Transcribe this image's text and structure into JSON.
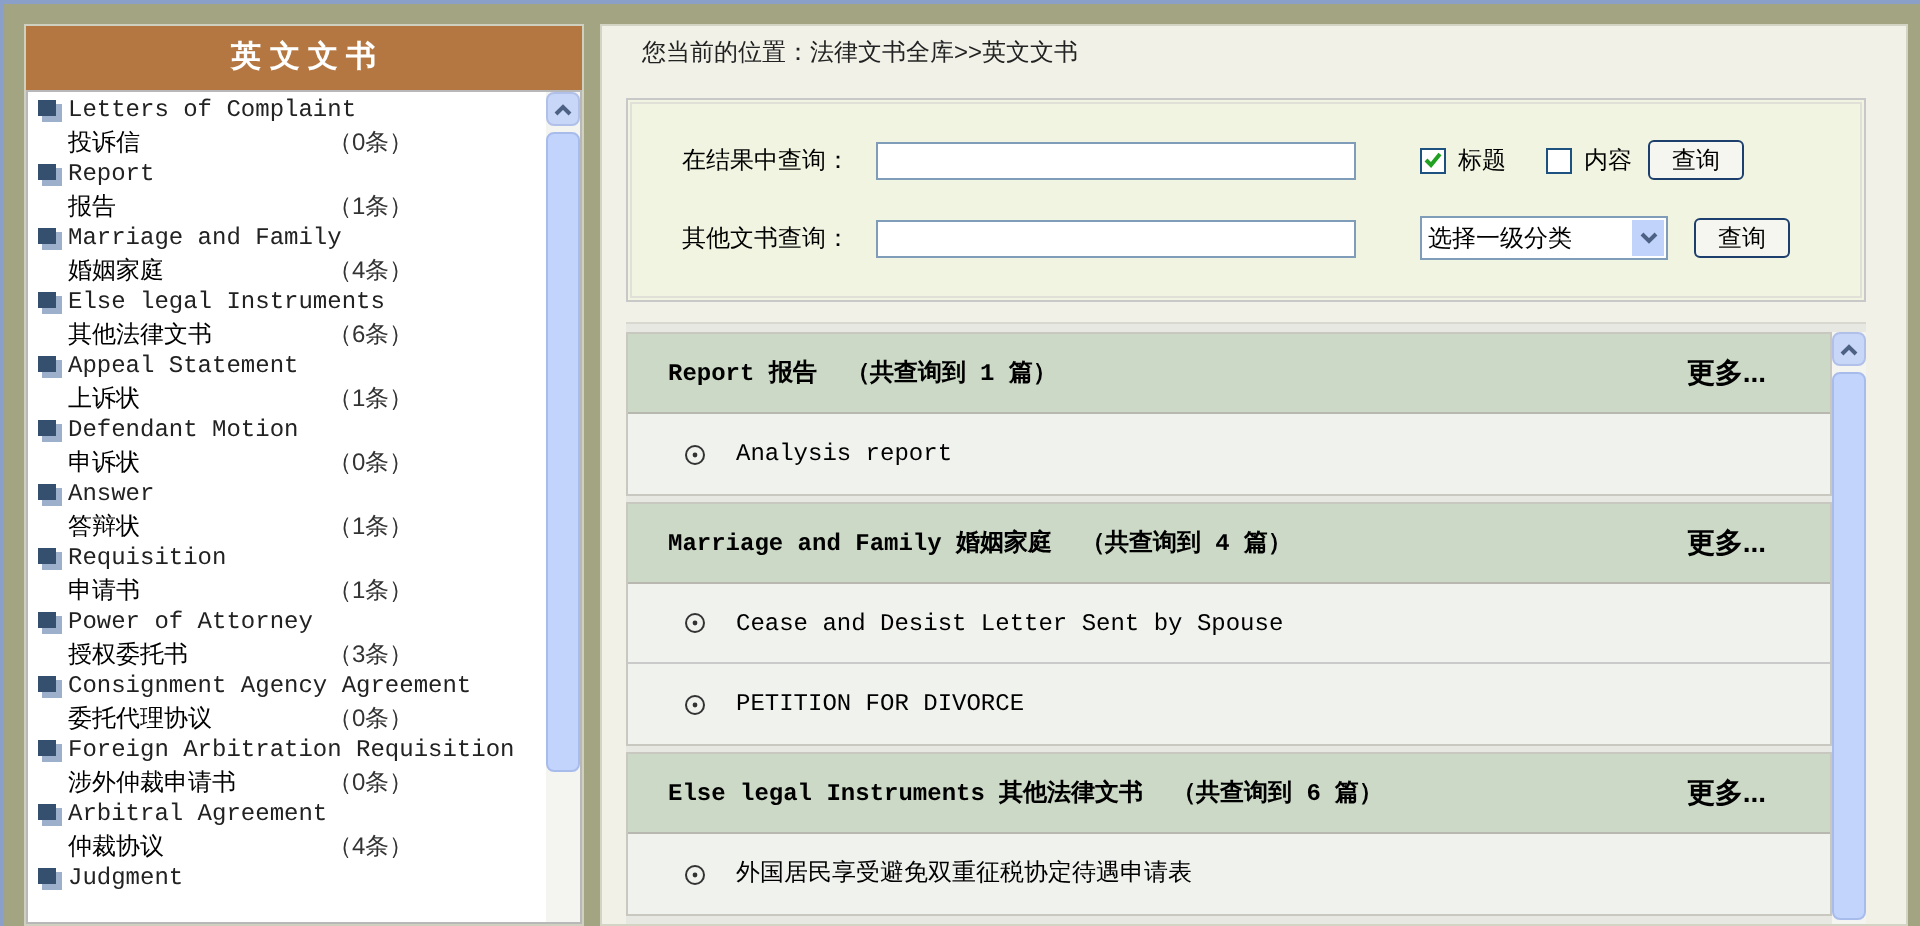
{
  "sidebar": {
    "title": "英 文 文 书",
    "items": [
      {
        "en": "Letters of Complaint",
        "zh": "投诉信",
        "count": "（0条）"
      },
      {
        "en": "Report",
        "zh": "报告",
        "count": "（1条）"
      },
      {
        "en": "Marriage and Family",
        "zh": "婚姻家庭",
        "count": "（4条）"
      },
      {
        "en": "Else legal Instruments",
        "zh": "其他法律文书",
        "count": "（6条）"
      },
      {
        "en": "Appeal Statement",
        "zh": "上诉状",
        "count": "（1条）"
      },
      {
        "en": "Defendant Motion",
        "zh": "申诉状",
        "count": "（0条）"
      },
      {
        "en": "Answer",
        "zh": "答辩状",
        "count": "（1条）"
      },
      {
        "en": "Requisition",
        "zh": "申请书",
        "count": "（1条）"
      },
      {
        "en": "Power of Attorney",
        "zh": "授权委托书",
        "count": "（3条）"
      },
      {
        "en": "Consignment Agency Agreement",
        "zh": "委托代理协议",
        "count": "（0条）"
      },
      {
        "en": "Foreign Arbitration Requisition",
        "zh": "涉外仲裁申请书",
        "count": "（0条）"
      },
      {
        "en": "Arbitral Agreement",
        "zh": "仲裁协议",
        "count": "（4条）"
      },
      {
        "en": "Judgment"
      }
    ]
  },
  "breadcrumb": "您当前的位置：法律文书全库>>英文文书",
  "search": {
    "row1": {
      "label": "在结果中查询：",
      "options": [
        {
          "label": "标题",
          "checked": true
        },
        {
          "label": "内容",
          "checked": false
        }
      ],
      "button": "查询"
    },
    "row2": {
      "label": "其他文书查询：",
      "select": "选择一级分类",
      "button": "查询"
    }
  },
  "results": [
    {
      "title": "Report 报告  （共查询到 1 篇）",
      "more": "更多...",
      "items": [
        "Analysis report"
      ]
    },
    {
      "title": "Marriage and Family 婚姻家庭  （共查询到 4 篇）",
      "more": "更多...",
      "items": [
        "Cease and Desist Letter Sent by Spouse",
        "PETITION FOR DIVORCE"
      ]
    },
    {
      "title": "Else legal Instruments 其他法律文书  （共查询到 6 篇）",
      "more": "更多...",
      "items": [
        "外国居民享受避免双重征税协定待遇申请表"
      ]
    }
  ]
}
